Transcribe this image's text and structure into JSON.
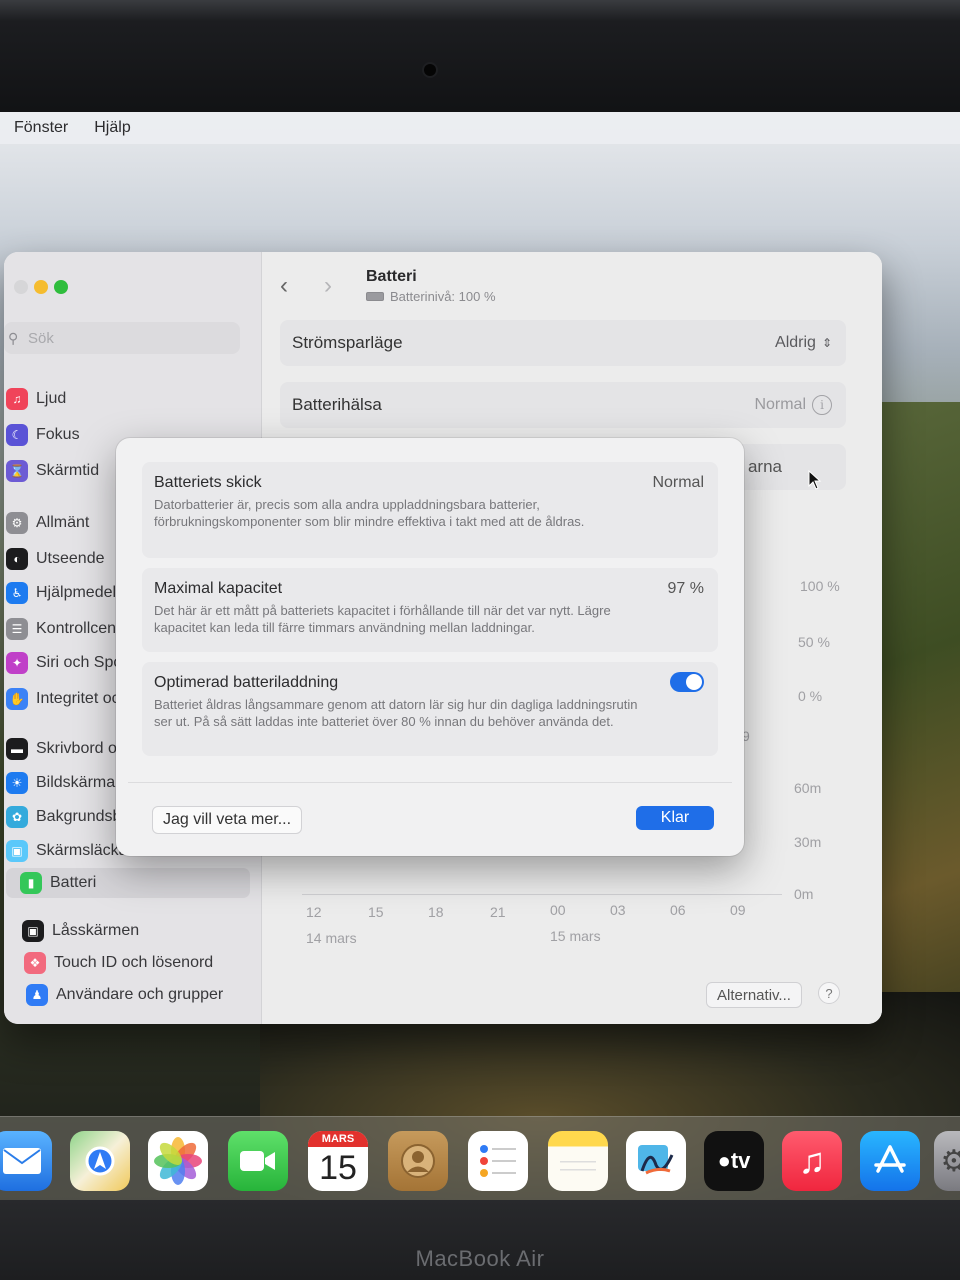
{
  "menubar": {
    "items": [
      "Fönster",
      "Hjälp"
    ]
  },
  "sidebar": {
    "search_placeholder": "Sök",
    "items": [
      {
        "label": "Ljud",
        "icon": "speaker-icon",
        "color": "#f0445a"
      },
      {
        "label": "Fokus",
        "icon": "moon-icon",
        "color": "#5a53d6"
      },
      {
        "label": "Skärmtid",
        "icon": "hourglass-icon",
        "color": "#6d5bd4"
      },
      {
        "label": "Allmänt",
        "icon": "gear-icon",
        "color": "#8e8e93"
      },
      {
        "label": "Utseende",
        "icon": "appearance-icon",
        "color": "#1c1c1e"
      },
      {
        "label": "Hjälpmedel",
        "icon": "accessibility-icon",
        "color": "#1d7bf0"
      },
      {
        "label": "Kontrollcenter",
        "icon": "control-center-icon",
        "color": "#8e8e93"
      },
      {
        "label": "Siri och Spotlight",
        "icon": "siri-icon",
        "color": "#c040c8"
      },
      {
        "label": "Integritet och säkerhet",
        "icon": "hand-icon",
        "color": "#3b82f6"
      },
      {
        "label": "Skrivbord och Dock",
        "icon": "dock-icon",
        "color": "#1c1c1e"
      },
      {
        "label": "Bildskärmar",
        "icon": "display-icon",
        "color": "#1d7bf0"
      },
      {
        "label": "Bakgrundsbild",
        "icon": "wallpaper-icon",
        "color": "#34aadc"
      },
      {
        "label": "Skärmsläckare",
        "icon": "screensaver-icon",
        "color": "#5ac8fa"
      },
      {
        "label": "Batteri",
        "icon": "battery-icon",
        "color": "#34c759"
      },
      {
        "label": "Låsskärmen",
        "icon": "lock-icon",
        "color": "#1c1c1e"
      },
      {
        "label": "Touch ID och lösenord",
        "icon": "fingerprint-icon",
        "color": "#f26a7e"
      },
      {
        "label": "Användare och grupper",
        "icon": "users-icon",
        "color": "#2f7bf5"
      }
    ]
  },
  "pane": {
    "title": "Batteri",
    "subtitle": "Batterinivå: 100 %",
    "power_mode_label": "Strömsparläge",
    "power_mode_value": "Aldrig",
    "health_label": "Batterihälsa",
    "health_value": "Normal",
    "partial_row_text": "arna",
    "chart_labels": {
      "pct": [
        "100 %",
        "50 %",
        "0 %"
      ],
      "mins": [
        "60m",
        "30m",
        "0m"
      ],
      "hours": [
        "12",
        "15",
        "18",
        "21",
        "00",
        "03",
        "06",
        "09"
      ],
      "dates": [
        "14 mars",
        "15 mars"
      ],
      "partial_nine": "9"
    },
    "alternatives_button": "Alternativ...",
    "help_button": "?"
  },
  "sheet": {
    "condition": {
      "title": "Batteriets skick",
      "value": "Normal",
      "description": "Datorbatterier är, precis som alla andra uppladdningsbara batterier, förbrukningskomponenter som blir mindre effektiva i takt med att de åldras."
    },
    "capacity": {
      "title": "Maximal kapacitet",
      "value": "97 %",
      "description": "Det här är ett mått på batteriets kapacitet i förhållande till när det var nytt. Lägre kapacitet kan leda till färre timmars användning mellan laddningar."
    },
    "optimized": {
      "title": "Optimerad batteriladdning",
      "enabled": true,
      "description": "Batteriet åldras långsammare genom att datorn lär sig hur din dagliga laddningsrutin ser ut. På så sätt laddas inte batteriet över 80 % innan du behöver använda det."
    },
    "learn_more_button": "Jag vill veta mer...",
    "done_button": "Klar"
  },
  "dock": {
    "calendar_month": "MARS",
    "calendar_day": "15",
    "apps": [
      "Mail",
      "Kartor",
      "Bilder",
      "FaceTime",
      "Kalender",
      "Kontakter",
      "Påminnelser",
      "Anteckningar",
      "Freeform",
      "TV",
      "Musik",
      "App Store",
      "Systeminställningar"
    ]
  },
  "device": {
    "brand": "MacBook Air"
  },
  "colors": {
    "accent": "#1f6ee8",
    "close": "#d6d6d8",
    "minimize": "#f5bc2f",
    "maximize": "#2fbd3d"
  }
}
